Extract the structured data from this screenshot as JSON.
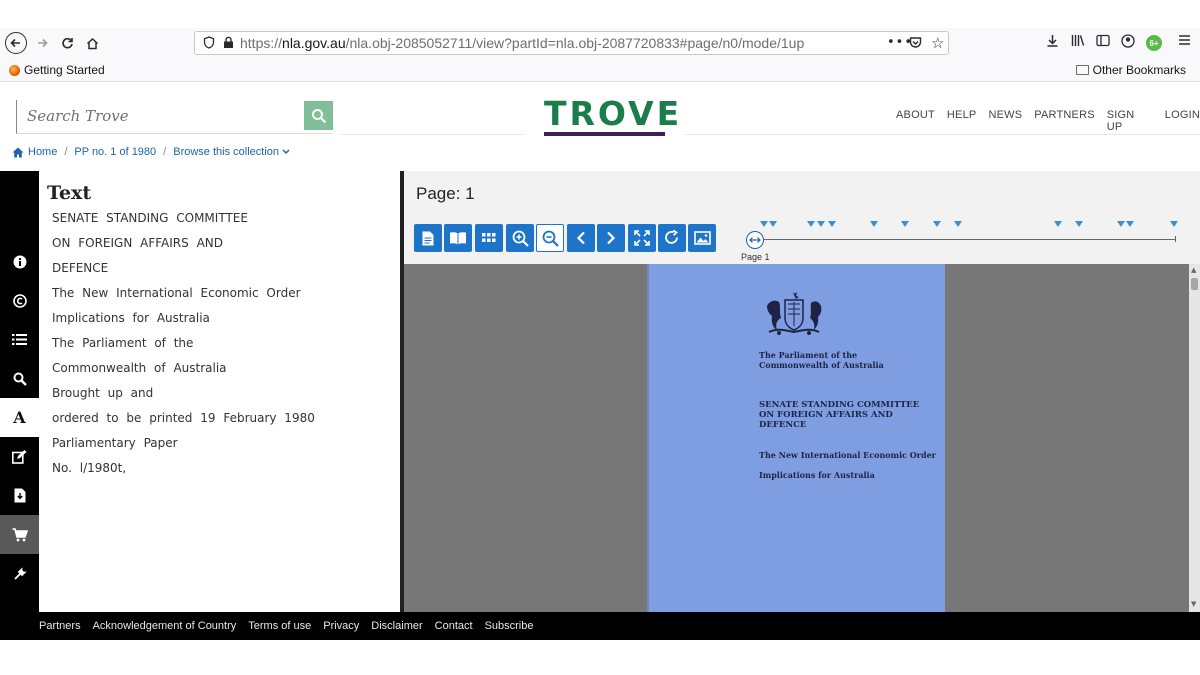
{
  "browser": {
    "url_scheme": "https://",
    "url_host": "nla.gov.au",
    "url_path": "/nla.obj-2085052711/view?partId=nla.obj-2087720833#page/n0/mode/1up",
    "ext_badge": "6+",
    "bookmarks": {
      "getting_started": "Getting Started",
      "other": "Other Bookmarks"
    }
  },
  "header": {
    "search_placeholder": "Search Trove",
    "logo": "TROVE",
    "nav": [
      "ABOUT",
      "HELP",
      "NEWS",
      "PARTNERS",
      "SIGN UP",
      "LOGIN"
    ]
  },
  "breadcrumb": {
    "home": "Home",
    "item": "PP no. 1 of 1980",
    "browse": "Browse this collection"
  },
  "text_panel": {
    "title": "Text",
    "lines": [
      "SENATE STANDING COMMITTEE",
      "ON FOREIGN AFFAIRS AND",
      "DEFENCE",
      "The New International Economic Order",
      "Implications for Australia",
      "The Parliament of the",
      "Commonwealth of Australia",
      "Brought up and",
      "ordered to be printed 19 February 1980",
      "Parliamentary Paper",
      "No. l/1980t,"
    ]
  },
  "viewer": {
    "page_label": "Page: 1",
    "slider_label": "Page 1",
    "marker_positions": [
      0.02,
      0.04,
      0.13,
      0.155,
      0.18,
      0.28,
      0.355,
      0.43,
      0.48,
      0.72,
      0.77,
      0.87,
      0.89,
      0.995
    ],
    "document": {
      "parliament": "The Parliament of the\nCommonwealth of Australia",
      "committee": "SENATE STANDING COMMITTEE\nON FOREIGN AFFAIRS AND\nDEFENCE",
      "subtitle": "The New International Economic Order",
      "implications": "Implications for Australia"
    }
  },
  "footer": [
    "Partners",
    "Acknowledgement of Country",
    "Terms of use",
    "Privacy",
    "Disclaimer",
    "Contact",
    "Subscribe"
  ]
}
